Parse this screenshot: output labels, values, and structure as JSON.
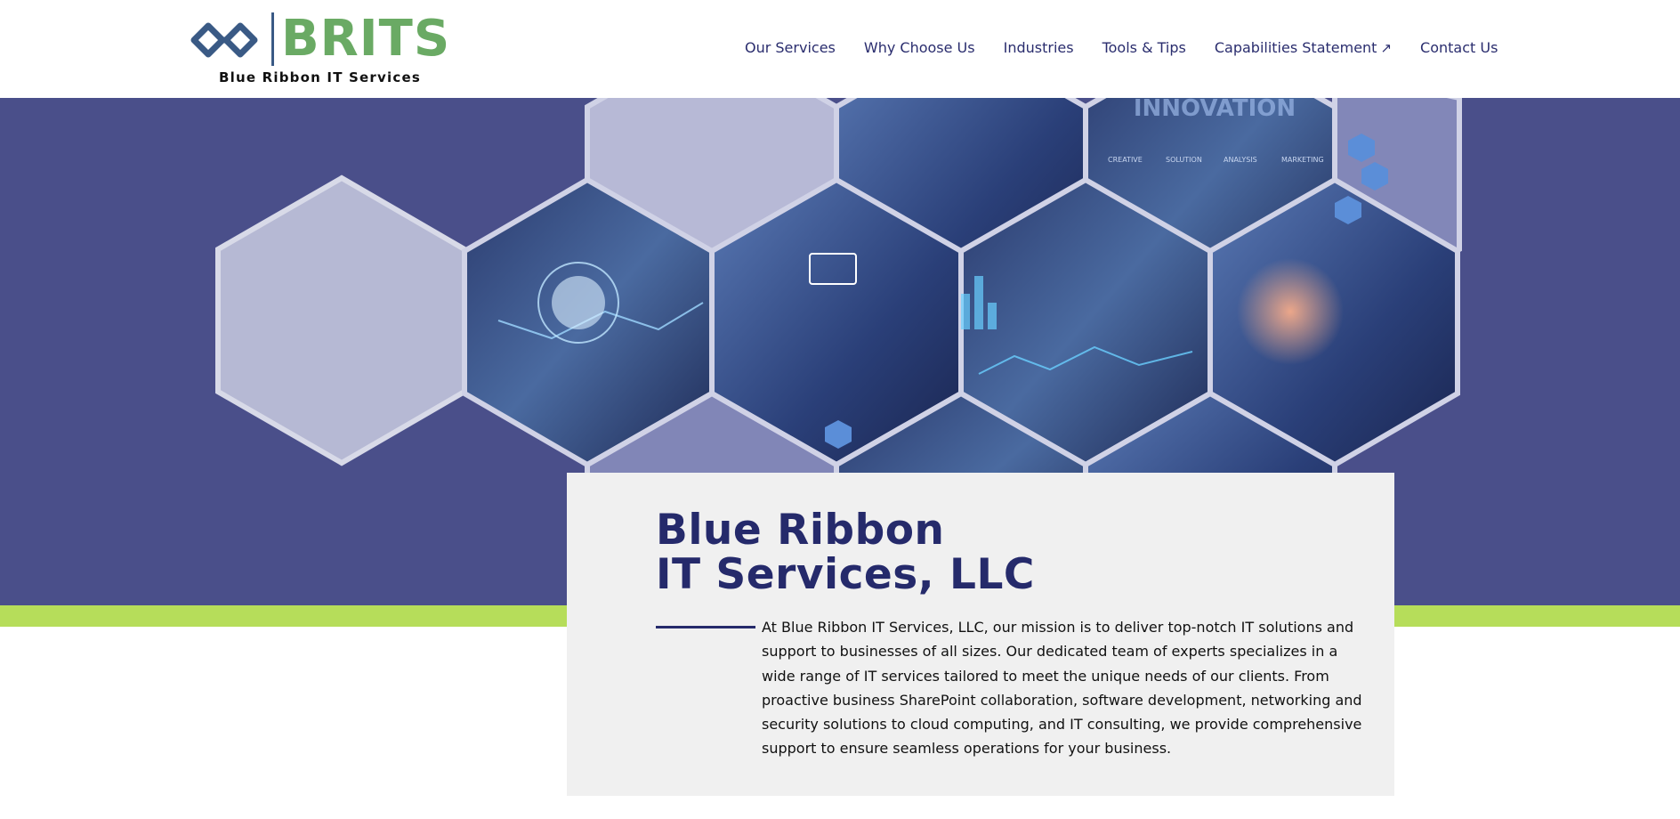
{
  "brand": {
    "name": "BRITS",
    "tagline": "Blue Ribbon IT Services",
    "colors": {
      "green": "#6aaa64",
      "navy": "#252a6b",
      "logo_blue": "#3a5a85"
    }
  },
  "nav": {
    "items": [
      {
        "label": "Our Services"
      },
      {
        "label": "Why Choose Us"
      },
      {
        "label": "Industries"
      },
      {
        "label": "Tools & Tips"
      },
      {
        "label": "Capabilities Statement",
        "icon": "external-link-icon"
      },
      {
        "label": "Contact Us"
      }
    ]
  },
  "hero": {
    "background_color": "#4a4f8a",
    "accent_band_color": "#b6dd5a",
    "overlay_text": "INNOVATION",
    "overlay_labels": [
      "CREATIVE",
      "SOLUTION",
      "ANALYSIS",
      "MARKETING"
    ]
  },
  "card": {
    "title_line1": "Blue Ribbon",
    "title_line2": "IT Services, LLC",
    "body": "At Blue Ribbon IT Services, LLC, our mission is to deliver top-notch IT solutions and support to businesses of all sizes. Our dedicated team of experts specializes in a wide range of IT services tailored to meet the unique needs of our clients. From proactive business SharePoint collaboration, software development, networking and security solutions to cloud computing, and IT consulting, we provide comprehensive support to ensure seamless operations for your business."
  }
}
